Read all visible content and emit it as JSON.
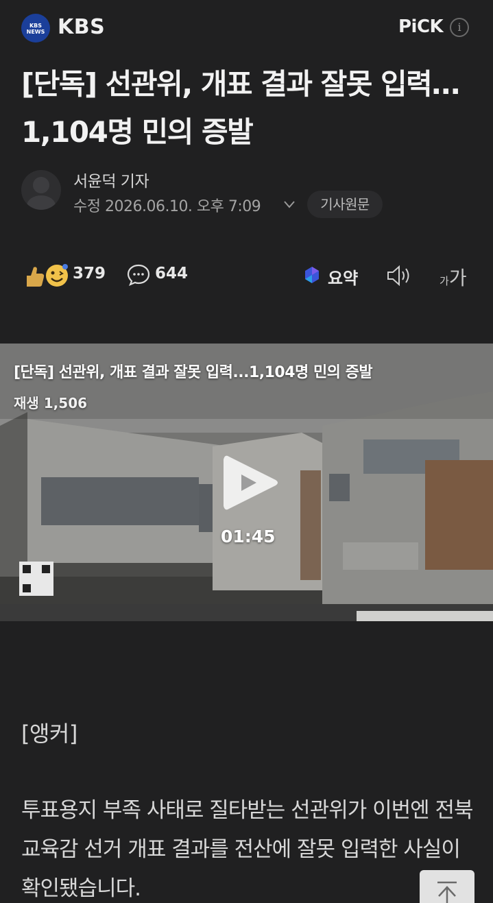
{
  "header": {
    "logo_text": "KBS NEWS",
    "brand": "KBS",
    "pick_label": "PiCK",
    "info_glyph": "i"
  },
  "article": {
    "title": "[단독] 선관위, 개표 결과 잘못 입력…1,104명 민의 증발",
    "author": "서윤덕 기자",
    "date": "수정 2026.06.10. 오후 7:09",
    "origin_button": "기사원문"
  },
  "stats": {
    "reactions": "379",
    "comments": "644",
    "summary_label": "요약",
    "font_small": "가",
    "font_big": "가"
  },
  "video": {
    "title": "[단독] 선관위, 개표 결과 잘못 입력...1,104명 민의 증발",
    "views": "재생 1,506",
    "duration": "01:45"
  },
  "body": {
    "anchor": "[앵커]",
    "paragraph": "투표용지 부족 사태로 질타받는 선관위가 이번엔 전북교육감 선거 개표 결과를 전산에 잘못 입력한 사실이 확인됐습니다."
  },
  "icons": {
    "logo": "kbs-logo-icon",
    "info": "info-icon",
    "chevron": "chevron-down-icon",
    "reactions": "reaction-emoji-icon",
    "comments": "comment-bubble-icon",
    "summary": "ai-summary-icon",
    "speaker": "speaker-icon",
    "play": "play-icon",
    "scroll_top": "arrow-up-icon"
  },
  "colors": {
    "background": "#202021",
    "kbs_blue": "#1b3f9a",
    "text": "#e8e8e8"
  }
}
